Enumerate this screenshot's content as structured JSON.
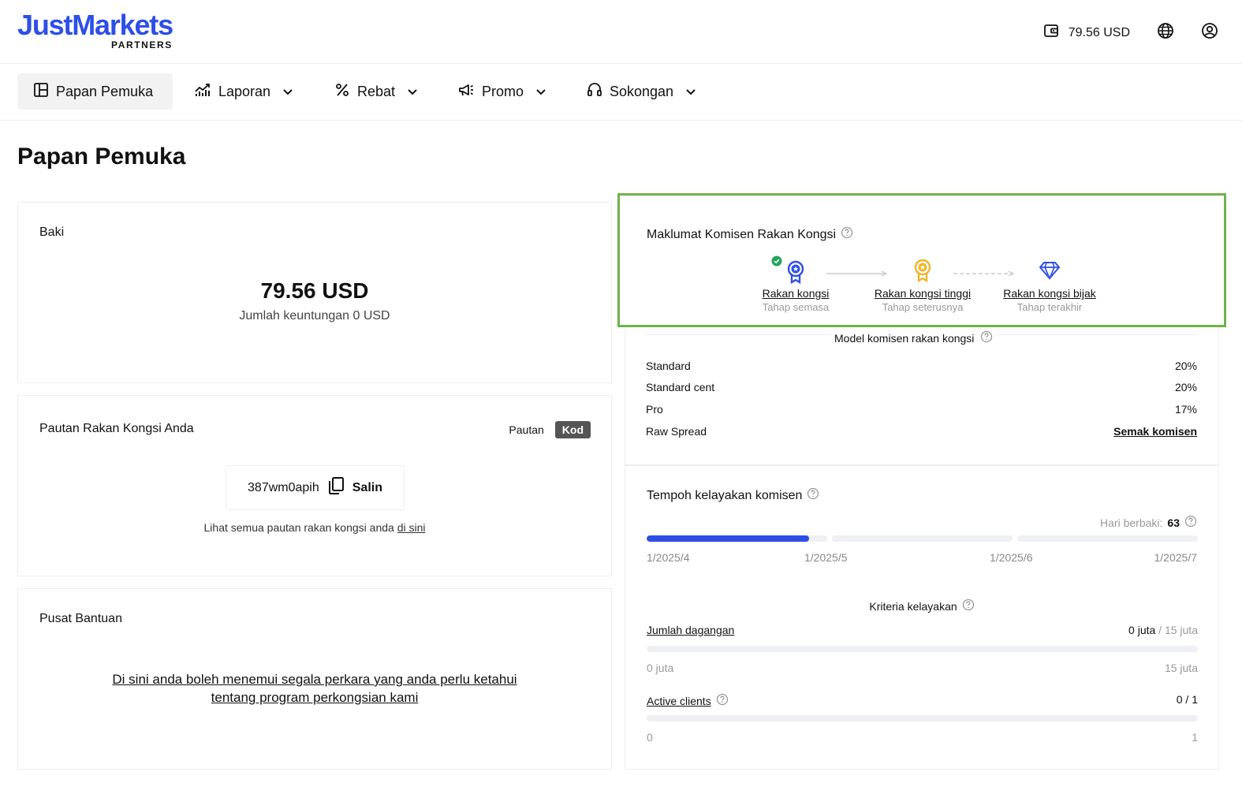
{
  "header": {
    "logo_main": "JustMarkets",
    "logo_sub": "PARTNERS",
    "balance": "79.56 USD"
  },
  "nav": {
    "items": [
      {
        "label": "Papan Pemuka"
      },
      {
        "label": "Laporan"
      },
      {
        "label": "Rebat"
      },
      {
        "label": "Promo"
      },
      {
        "label": "Sokongan"
      }
    ]
  },
  "page_title": "Papan Pemuka",
  "baki": {
    "title": "Baki",
    "amount": "79.56 USD",
    "sub": "Jumlah keuntungan 0 USD"
  },
  "pautan": {
    "title": "Pautan Rakan Kongsi Anda",
    "tab_pautan": "Pautan",
    "tab_kod": "Kod",
    "code": "387wm0apih",
    "copy_label": "Salin",
    "note_prefix": "Lihat semua pautan rakan kongsi anda",
    "note_link": "di sini"
  },
  "bantuan": {
    "title": "Pusat Bantuan",
    "line1": "Di sini anda boleh menemui segala perkara yang anda perlu ketahui",
    "line2": "tentang program perkongsian kami"
  },
  "komisen": {
    "title": "Maklumat Komisen Rakan Kongsi",
    "tiers": [
      {
        "name": "Rakan kongsi",
        "sub": "Tahap semasa",
        "color": "#2d4fe6"
      },
      {
        "name": "Rakan kongsi tinggi",
        "sub": "Tahap seterusnya",
        "color": "#f0b429"
      },
      {
        "name": "Rakan kongsi bijak",
        "sub": "Tahap terakhir",
        "color": "#2d4fe6"
      }
    ],
    "model_title": "Model komisen rakan kongsi",
    "models": [
      {
        "name": "Standard",
        "value": "20%"
      },
      {
        "name": "Standard cent",
        "value": "20%"
      },
      {
        "name": "Pro",
        "value": "17%"
      },
      {
        "name": "Raw Spread",
        "value": "Semak komisen"
      }
    ]
  },
  "tempoh": {
    "title": "Tempoh kelayakan komisen",
    "hari_label": "Hari berbaki:",
    "hari_value": "63",
    "progress_fraction": 0.3,
    "dates": [
      "1/2025/4",
      "1/2025/5",
      "1/2025/6",
      "1/2025/7"
    ],
    "kriteria_title": "Kriteria kelayakan",
    "criteria": [
      {
        "label": "Jumlah dagangan",
        "current": "0 juta",
        "target": "15 juta",
        "min": "0 juta",
        "max": "15 juta"
      },
      {
        "label": "Active clients",
        "current": "0",
        "target": "1",
        "min": "0",
        "max": "1"
      }
    ]
  },
  "colors": {
    "brand": "#2d4fe6",
    "highlight": "#6fb24a",
    "gold": "#f0b429",
    "check": "#22a35a"
  }
}
